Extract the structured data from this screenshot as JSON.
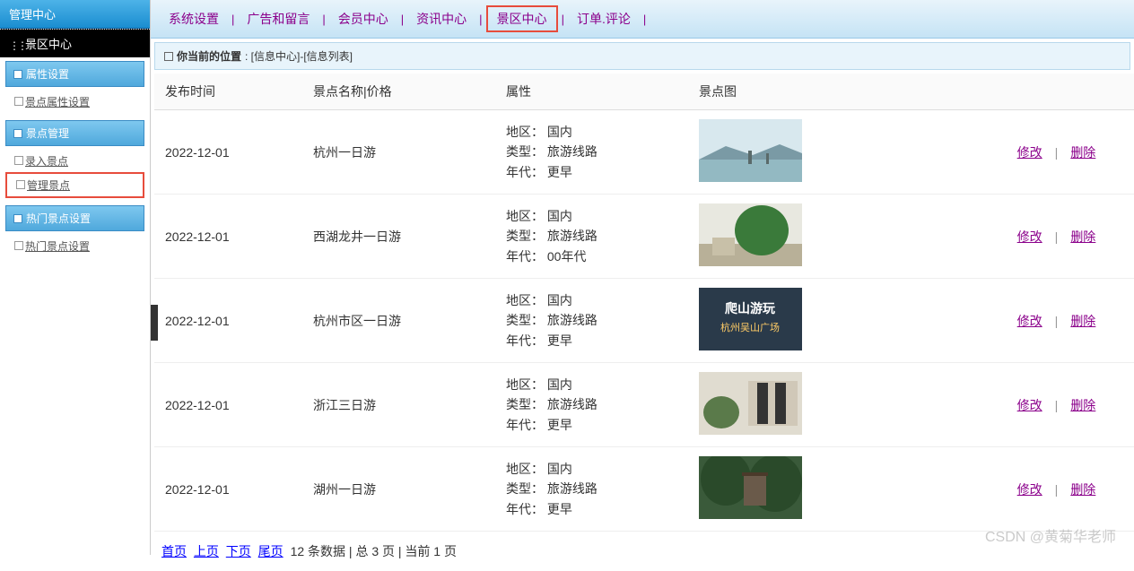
{
  "sidebar": {
    "header": "管理中心",
    "title": "景区中心",
    "groups": [
      {
        "header": "属性设置",
        "items": [
          {
            "label": "景点属性设置",
            "highlighted": false
          }
        ]
      },
      {
        "header": "景点管理",
        "items": [
          {
            "label": "录入景点",
            "highlighted": false
          },
          {
            "label": "管理景点",
            "highlighted": true
          }
        ]
      },
      {
        "header": "热门景点设置",
        "items": [
          {
            "label": "热门景点设置",
            "highlighted": false
          }
        ]
      }
    ]
  },
  "topnav": [
    {
      "label": "系统设置",
      "highlighted": false
    },
    {
      "label": "广告和留言",
      "highlighted": false
    },
    {
      "label": "会员中心",
      "highlighted": false
    },
    {
      "label": "资讯中心",
      "highlighted": false
    },
    {
      "label": "景区中心",
      "highlighted": true
    },
    {
      "label": "订单.评论",
      "highlighted": false
    }
  ],
  "breadcrumb": {
    "label": "你当前的位置",
    "path": ": [信息中心]-[信息列表]"
  },
  "table": {
    "headers": [
      "发布时间",
      "景点名称|价格",
      "属性",
      "景点图",
      ""
    ],
    "attr_labels": {
      "region": "地区",
      "type": "类型",
      "era": "年代"
    },
    "rows": [
      {
        "date": "2022-12-01",
        "name": "杭州一日游",
        "region": "国内",
        "type": "旅游线路",
        "era": "更早"
      },
      {
        "date": "2022-12-01",
        "name": "西湖龙井一日游",
        "region": "国内",
        "type": "旅游线路",
        "era": "00年代"
      },
      {
        "date": "2022-12-01",
        "name": "杭州市区一日游",
        "region": "国内",
        "type": "旅游线路",
        "era": "更早"
      },
      {
        "date": "2022-12-01",
        "name": "浙江三日游",
        "region": "国内",
        "type": "旅游线路",
        "era": "更早"
      },
      {
        "date": "2022-12-01",
        "name": "湖州一日游",
        "region": "国内",
        "type": "旅游线路",
        "era": "更早"
      }
    ],
    "actions": {
      "edit": "修改",
      "delete": "删除"
    }
  },
  "pagination": {
    "first": "首页",
    "prev": "上页",
    "next": "下页",
    "last": "尾页",
    "summary": "12 条数据 | 总 3 页 | 当前 1 页"
  },
  "watermark": "CSDN @黄菊华老师",
  "thumbs": [
    "<svg viewBox='0 0 115 70'><rect width='115' height='45' fill='#d8e8ee'/><rect y='45' width='115' height='25' fill='#93b9c2'/><polygon points='0,45 30,30 60,40 90,28 115,38 115,45' fill='#7a9aa5'/><rect x='55' y='35' width='4' height='15' fill='#5a6a6a'/><rect x='75' y='38' width='3' height='12' fill='#5a6a6a'/></svg>",
    "<svg viewBox='0 0 115 70'><rect width='115' height='70' fill='#e8e8e0'/><rect x='0' y='45' width='115' height='25' fill='#b8b098'/><ellipse cx='70' cy='30' rx='30' ry='28' fill='#3a7a3a'/><rect x='15' y='38' width='25' height='20' fill='#c8c0a8'/></svg>",
    "<svg viewBox='0 0 115 70'><rect width='115' height='70' fill='#2a3a4a'/><text x='57' y='28' fill='#fff' font-size='14' text-anchor='middle' font-weight='bold'>爬山游玩</text><text x='57' y='48' fill='#ffcc66' font-size='11' text-anchor='middle'>杭州吴山广场</text></svg>",
    "<svg viewBox='0 0 115 70'><rect width='115' height='70' fill='#e0dcd0'/><rect x='55' y='10' width='55' height='50' fill='#d0c8b8'/><rect x='65' y='12' width='12' height='46' fill='#333'/><rect x='85' y='12' width='12' height='46' fill='#333'/><ellipse cx='25' cy='45' rx='20' ry='18' fill='#5a7a4a'/></svg>",
    "<svg viewBox='0 0 115 70'><rect width='115' height='70' fill='#3a5a3a'/><ellipse cx='30' cy='25' rx='28' ry='30' fill='#2a4a2a'/><ellipse cx='85' cy='30' rx='30' ry='32' fill='#2a4a2a'/><rect x='50' y='20' width='25' height='35' fill='#6a5a4a'/><rect x='48' y='18' width='29' height='4' fill='#4a3a2a'/></svg>"
  ]
}
